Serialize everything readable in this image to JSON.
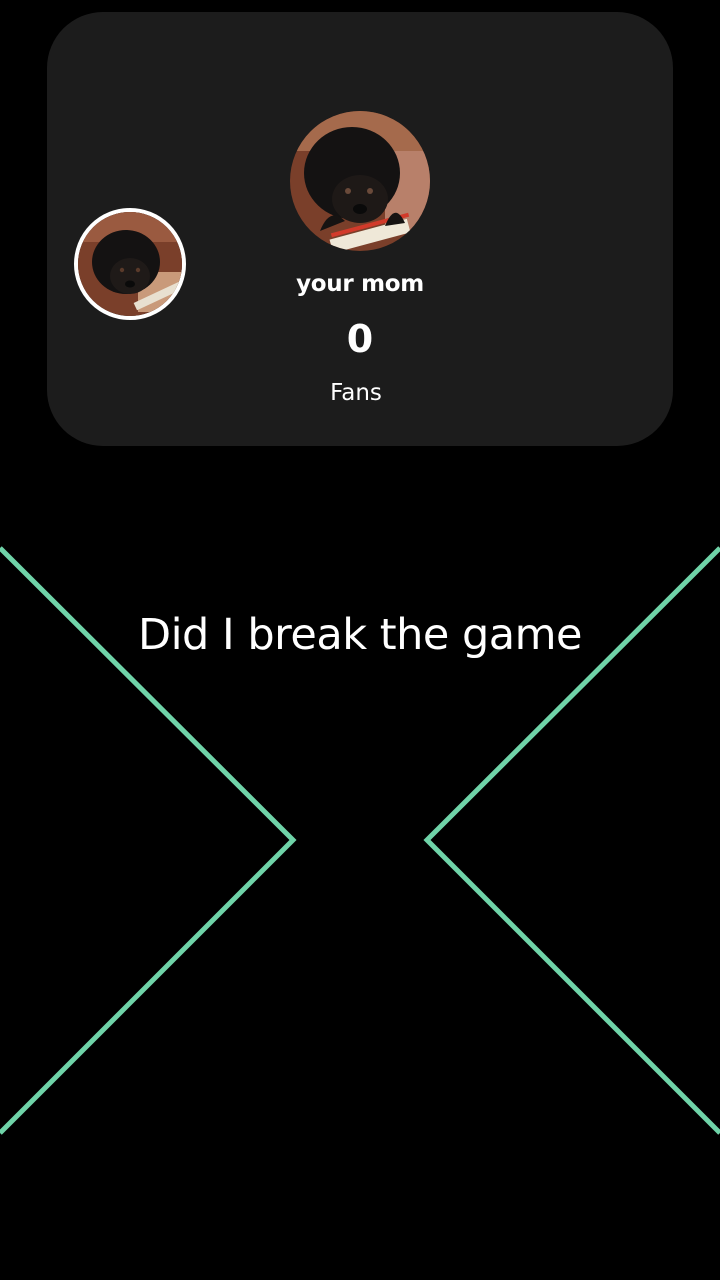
{
  "profile": {
    "username": "your mom",
    "fans_count": "0",
    "fans_label": "Fans",
    "small_avatar_icon": "dog-photo-avatar",
    "main_avatar_icon": "dog-photo-avatar"
  },
  "caption": "Did I break the game",
  "colors": {
    "background": "#000000",
    "card": "#1c1c1c",
    "accent_lines": "#6fd3a8",
    "text": "#ffffff"
  }
}
